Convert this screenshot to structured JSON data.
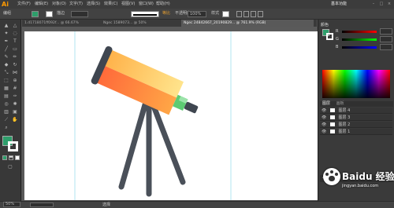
{
  "app": {
    "logo": "Ai",
    "workspace": "基本功能"
  },
  "menu": [
    "文件(F)",
    "编辑(E)",
    "对象(O)",
    "文字(T)",
    "选择(S)",
    "效果(C)",
    "视图(V)",
    "窗口(W)",
    "帮助(H)"
  ],
  "control": {
    "selection_label": "编组",
    "stroke_label": "描边",
    "stroke_value": "等比",
    "opacity_label": "不透明度",
    "opacity_value": "100%",
    "style_label": "样式"
  },
  "tabs": [
    "1.d1718071ff092f... @ 66.67%",
    "Ngec 1589073... @ 50%",
    "Ngec 24842667_20190829... @ 761.9% (RGB)"
  ],
  "colors": {
    "fill": "#2e9e6b",
    "accent": "#ff9a00"
  },
  "panel": {
    "color_header": "颜色",
    "channels": [
      "R",
      "G",
      "B"
    ],
    "tabs": [
      "图层",
      "画板"
    ],
    "layers": [
      "图层 4",
      "图层 3",
      "图层 2",
      "图层 1"
    ],
    "layers_count": "4 个图层"
  },
  "status": {
    "zoom": "50%",
    "tool_name": "选择"
  },
  "watermark": {
    "text": "Baidu 经验",
    "url": "jingyan.baidu.com"
  }
}
